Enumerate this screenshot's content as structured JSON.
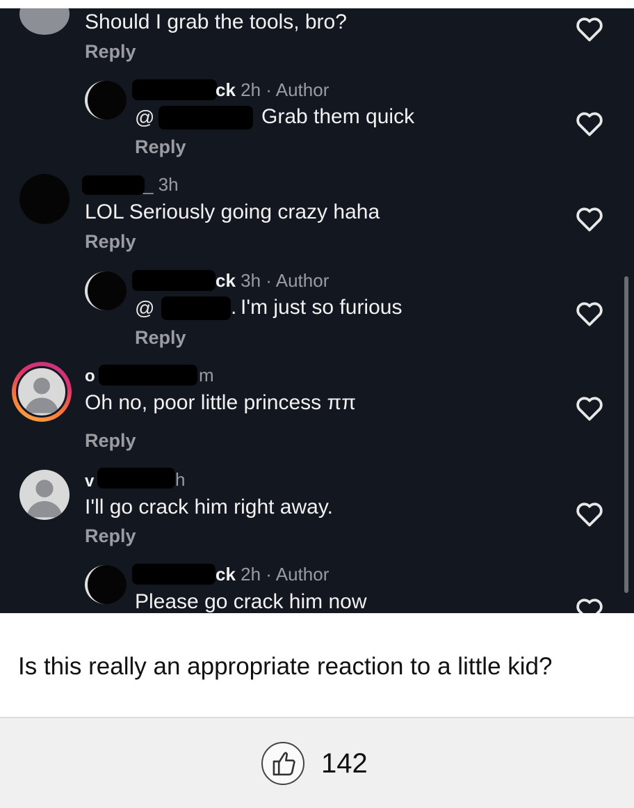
{
  "comments": [
    {
      "text": "Should I grab the tools, bro?",
      "reply": "Reply"
    },
    {
      "author_suffix": "ck",
      "meta": "2h · Author",
      "mention": "@",
      "text": "Grab them quick",
      "reply": "Reply"
    },
    {
      "meta": "_ 3h",
      "text": "LOL Seriously going crazy haha",
      "reply": "Reply"
    },
    {
      "author_suffix": "ck",
      "meta": "3h · Author",
      "mention": "@",
      "text": "I'm just so furious",
      "reply": "Reply",
      "punct": "."
    },
    {
      "author_prefix": "o",
      "time_fragment": "m",
      "text": "Oh no, poor little princess ππ",
      "reply": "Reply"
    },
    {
      "author_prefix": "v",
      "time_fragment": "h",
      "text": "I'll go crack him right away.",
      "reply": "Reply"
    },
    {
      "author_suffix": "ck",
      "meta": "2h · Author",
      "text": "Please go crack him now"
    }
  ],
  "caption": "Is this really an appropriate reaction to a little kid?",
  "like_count": "142",
  "icons": {
    "like": "heart-outline-icon",
    "thumb": "thumbs-up-icon",
    "avatar": "default-user-avatar-icon"
  }
}
